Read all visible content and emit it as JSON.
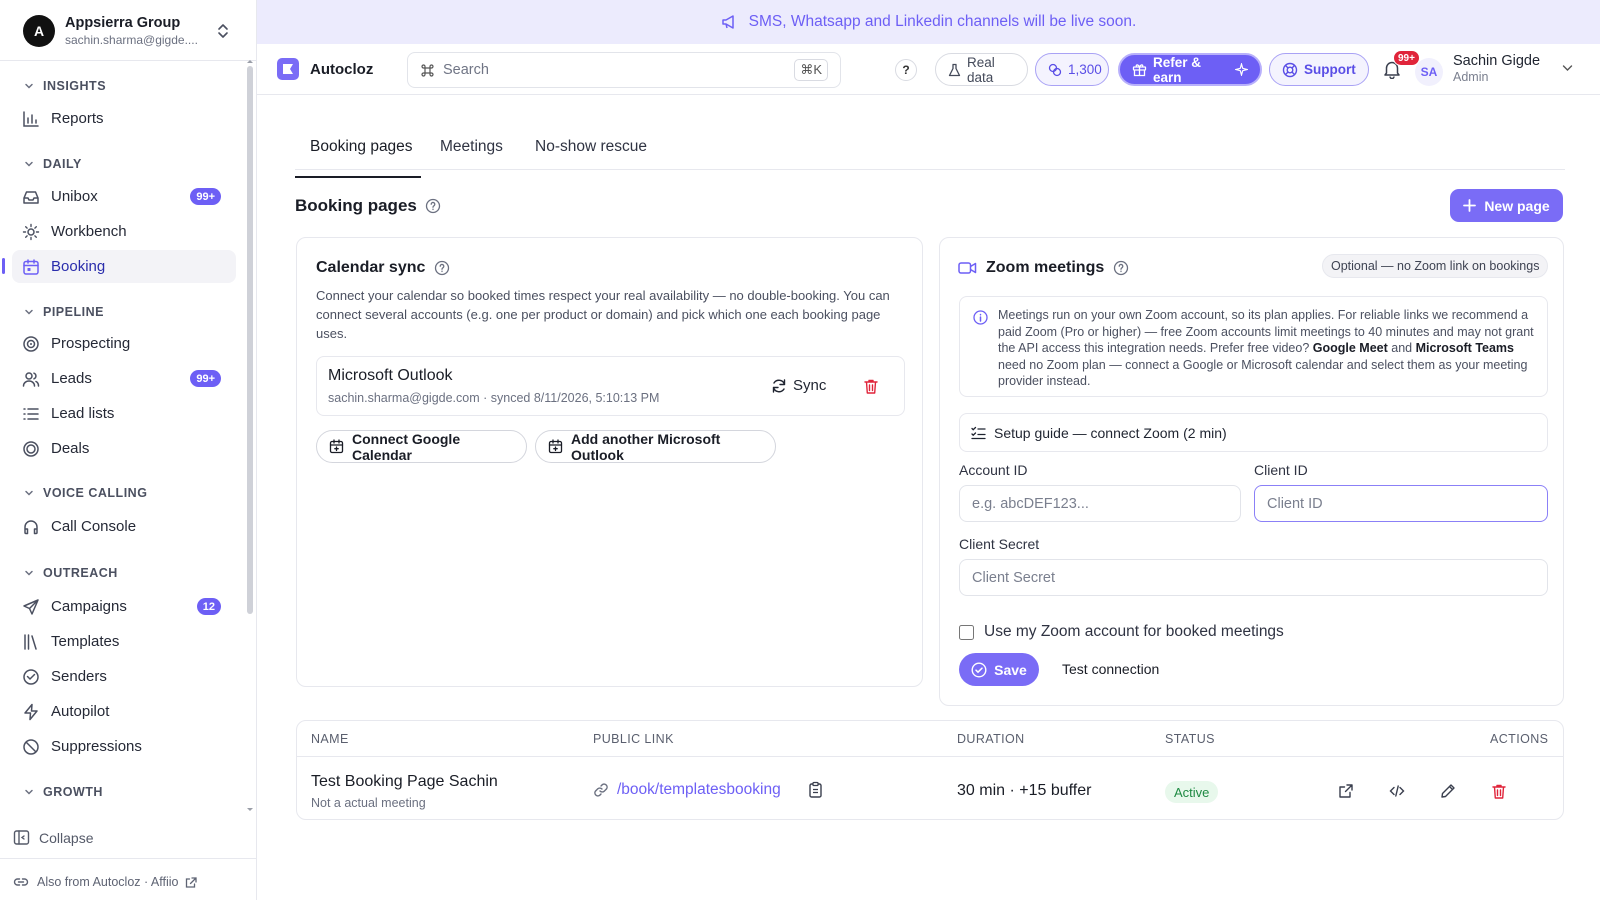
{
  "org": {
    "avatar_letter": "A",
    "name": "Appsierra Group",
    "email": "sachin.sharma@gigde...."
  },
  "sidebar": {
    "sections": [
      {
        "label": "INSIGHTS"
      },
      {
        "label": "DAILY"
      },
      {
        "label": "PIPELINE"
      },
      {
        "label": "VOICE CALLING"
      },
      {
        "label": "OUTREACH"
      },
      {
        "label": "GROWTH"
      }
    ],
    "items": [
      {
        "label": "Reports",
        "icon": "bar-chart-icon"
      },
      {
        "label": "Unibox",
        "icon": "inbox-icon",
        "badge": "99+"
      },
      {
        "label": "Workbench",
        "icon": "sun-icon"
      },
      {
        "label": "Booking",
        "icon": "calendar-icon",
        "active": true
      },
      {
        "label": "Prospecting",
        "icon": "target-icon"
      },
      {
        "label": "Leads",
        "icon": "users-icon",
        "badge": "99+"
      },
      {
        "label": "Lead lists",
        "icon": "list-icon"
      },
      {
        "label": "Deals",
        "icon": "deals-icon"
      },
      {
        "label": "Call Console",
        "icon": "headset-icon"
      },
      {
        "label": "Campaigns",
        "icon": "send-icon",
        "badge": "12"
      },
      {
        "label": "Templates",
        "icon": "library-icon"
      },
      {
        "label": "Senders",
        "icon": "sender-icon"
      },
      {
        "label": "Autopilot",
        "icon": "bolt-icon"
      },
      {
        "label": "Suppressions",
        "icon": "ban-icon"
      }
    ],
    "collapse_label": "Collapse",
    "also_from": "Also from Autocloz · Affiio"
  },
  "banner": {
    "text": "SMS, Whatsapp and Linkedin channels will be live soon."
  },
  "topbar": {
    "brand": "Autocloz",
    "search_placeholder": "Search",
    "search_shortcut": "⌘K",
    "help": "?",
    "real_data": "Real data",
    "credits": "1,300",
    "refer": "Refer & earn",
    "support": "Support",
    "notifications": "99+",
    "user_initials": "SA",
    "user_name": "Sachin Gigde",
    "user_role": "Admin"
  },
  "tabs": [
    "Booking pages",
    "Meetings",
    "No-show rescue"
  ],
  "page": {
    "title": "Booking pages",
    "new_button": "New page"
  },
  "calendar_sync": {
    "title": "Calendar sync",
    "description": "Connect your calendar so booked times respect your real availability — no double-booking. You can connect several accounts (e.g. one per product or domain) and pick which one each booking page uses.",
    "account": {
      "provider": "Microsoft Outlook",
      "meta": "sachin.sharma@gigde.com · synced 8/11/2026, 5:10:13 PM",
      "sync_label": "Sync"
    },
    "connect_google": "Connect Google Calendar",
    "add_outlook": "Add another Microsoft Outlook"
  },
  "zoom": {
    "title": "Zoom meetings",
    "optional_tag": "Optional — no Zoom link on bookings",
    "info_1": "Meetings run on your own Zoom account, so its plan applies. For reliable links we recommend a paid Zoom (Pro or higher) — free Zoom accounts limit meetings to 40 minutes and may not grant the API access this integration needs. Prefer free video? ",
    "info_gm": "Google Meet",
    "info_and": " and ",
    "info_mt": "Microsoft Teams",
    "info_2": " need no Zoom plan — connect a Google or Microsoft calendar and select them as your meeting provider instead.",
    "setup_guide": "Setup guide — connect Zoom (2 min)",
    "account_id_label": "Account ID",
    "account_id_placeholder": "e.g. abcDEF123...",
    "client_id_label": "Client ID",
    "client_id_placeholder": "Client ID",
    "client_secret_label": "Client Secret",
    "client_secret_placeholder": "Client Secret",
    "use_zoom_label": "Use my Zoom account for booked meetings",
    "save": "Save",
    "test": "Test connection"
  },
  "table": {
    "headers": [
      "NAME",
      "PUBLIC LINK",
      "DURATION",
      "STATUS",
      "ACTIONS"
    ],
    "rows": [
      {
        "name": "Test Booking Page Sachin",
        "description": "Not a actual meeting",
        "link": "/book/templatesbooking",
        "duration": "30 min · +15 buffer",
        "status": "Active"
      }
    ]
  },
  "colors": {
    "accent": "#6d5ff5",
    "banner_bg": "#ecebfd",
    "danger": "#e0243a",
    "success": "#1f8a43"
  }
}
